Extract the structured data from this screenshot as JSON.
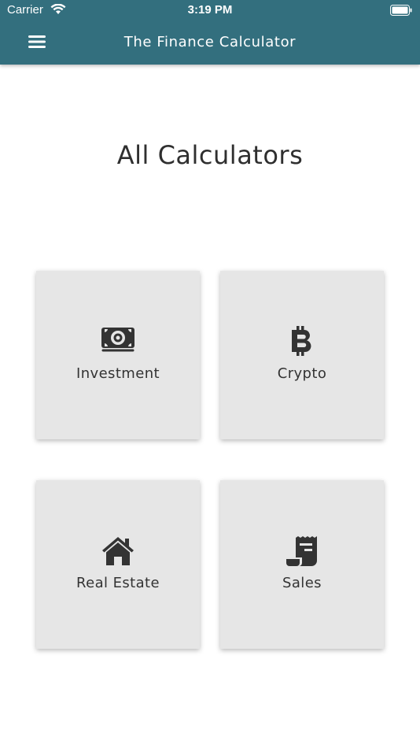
{
  "status_bar": {
    "carrier": "Carrier",
    "time": "3:19 PM"
  },
  "header": {
    "title": "The Finance Calculator",
    "background_color": "#336f7e"
  },
  "page": {
    "heading": "All Calculators"
  },
  "calculators": [
    {
      "label": "Investment",
      "icon": "money-bill-icon"
    },
    {
      "label": "Crypto",
      "icon": "bitcoin-icon"
    },
    {
      "label": "Real Estate",
      "icon": "home-icon"
    },
    {
      "label": "Sales",
      "icon": "receipt-icon"
    }
  ],
  "colors": {
    "card_background": "#e6e6e6",
    "icon_color": "#333333"
  }
}
